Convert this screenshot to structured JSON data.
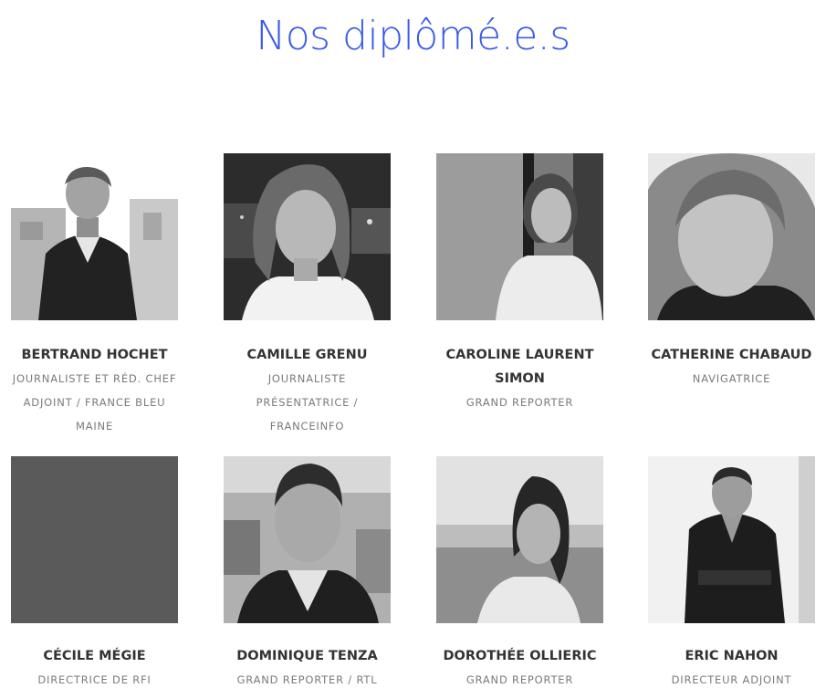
{
  "page": {
    "title": "Nos diplômé.e.s"
  },
  "colors": {
    "title": "#3b5be7",
    "name": "#333333",
    "role": "#7b7b7b",
    "placeholder_photo": "#5a5a5a"
  },
  "graduates": [
    {
      "name": "BERTRAND HOCHET",
      "role_lines": [
        "JOURNALISTE ET RÉD. CHEF",
        "ADJOINT / FRANCE BLEU",
        "MAINE"
      ],
      "photo": "portrait-man-suit-city"
    },
    {
      "name": "CAMILLE GRENU",
      "role_lines": [
        "JOURNALISTE",
        "PRÉSENTATRICE /",
        "FRANCEINFO"
      ],
      "photo": "portrait-woman-night-city"
    },
    {
      "name_lines": [
        "CAROLINE LAURENT",
        "SIMON"
      ],
      "role_lines": [
        "GRAND REPORTER"
      ],
      "photo": "portrait-woman-window"
    },
    {
      "name": "CATHERINE CHABAUD",
      "role_lines": [
        "NAVIGATRICE"
      ],
      "photo": "portrait-woman-outdoor-closeup"
    },
    {
      "name": "CÉCILE MÉGIE",
      "role_lines": [
        "DIRECTRICE DE RFI"
      ],
      "photo": "placeholder-gray"
    },
    {
      "name": "DOMINIQUE TENZA",
      "role_lines": [
        "GRAND REPORTER / RTL"
      ],
      "photo": "portrait-man-office"
    },
    {
      "name": "DOROTHÉE OLLIERIC",
      "role_lines": [
        "GRAND REPORTER"
      ],
      "photo": "portrait-woman-field"
    },
    {
      "name": "ERIC NAHON",
      "role_lines": [
        "DIRECTEUR ADJOINT"
      ],
      "photo": "portrait-man-seated"
    }
  ]
}
